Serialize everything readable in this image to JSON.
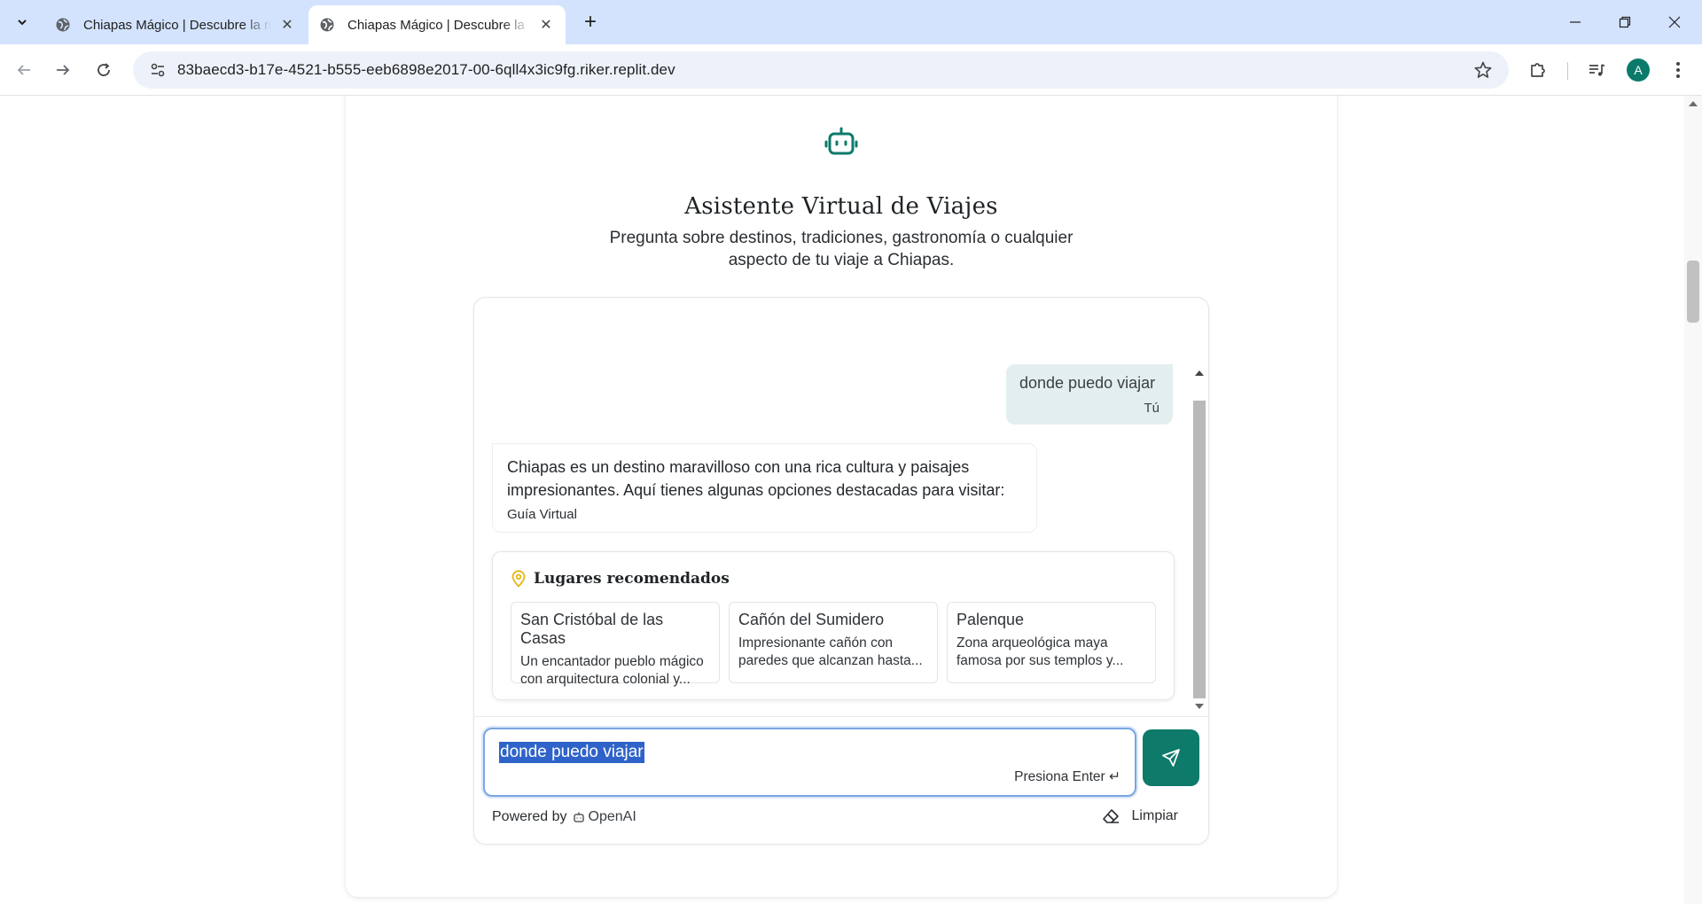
{
  "browser": {
    "tabs": [
      {
        "title": "Chiapas Mágico | Descubre la magia de Chiapas",
        "active": false
      },
      {
        "title": "Chiapas Mágico | Descubre la magia de Chiapas",
        "active": true
      }
    ],
    "url": "83baecd3-b17e-4521-b555-eeb6898e2017-00-6qll4x3ic9fg.riker.replit.dev",
    "profile_initial": "A"
  },
  "header": {
    "title": "Asistente Virtual de Viajes",
    "subtitle": "Pregunta sobre destinos, tradiciones, gastronomía o cualquier aspecto de tu viaje a Chiapas."
  },
  "chat": {
    "messages": [
      {
        "role": "user",
        "text": "donde puedo viajar",
        "sender": "Tú"
      },
      {
        "role": "assistant",
        "text": "Chiapas es un destino maravilloso con una rica cultura y paisajes impresionantes. Aquí tienes algunas opciones destacadas para visitar:",
        "sender": "Guía Virtual"
      }
    ],
    "recommendations": {
      "title": "Lugares recomendados",
      "places": [
        {
          "name": "San Cristóbal de las Casas",
          "description": "Un encantador pueblo mágico con arquitectura colonial y..."
        },
        {
          "name": "Cañón del Sumidero",
          "description": "Impresionante cañón con paredes que alcanzan hasta..."
        },
        {
          "name": "Palenque",
          "description": "Zona arqueológica maya famosa por sus templos y..."
        }
      ]
    },
    "input": {
      "value": "donde puedo viajar",
      "hint": "Presiona Enter ↵"
    },
    "footer": {
      "powered_label": "Powered by",
      "brand": "OpenAI",
      "clear_label": "Limpiar"
    }
  },
  "colors": {
    "accent": "#0d7a6a",
    "pin": "#e7b416",
    "user_bubble": "#e3efee",
    "tabbar": "#d3e3fd"
  },
  "icons": [
    "robot-icon",
    "map-pin-icon",
    "send-icon",
    "eraser-icon",
    "openai-icon"
  ]
}
